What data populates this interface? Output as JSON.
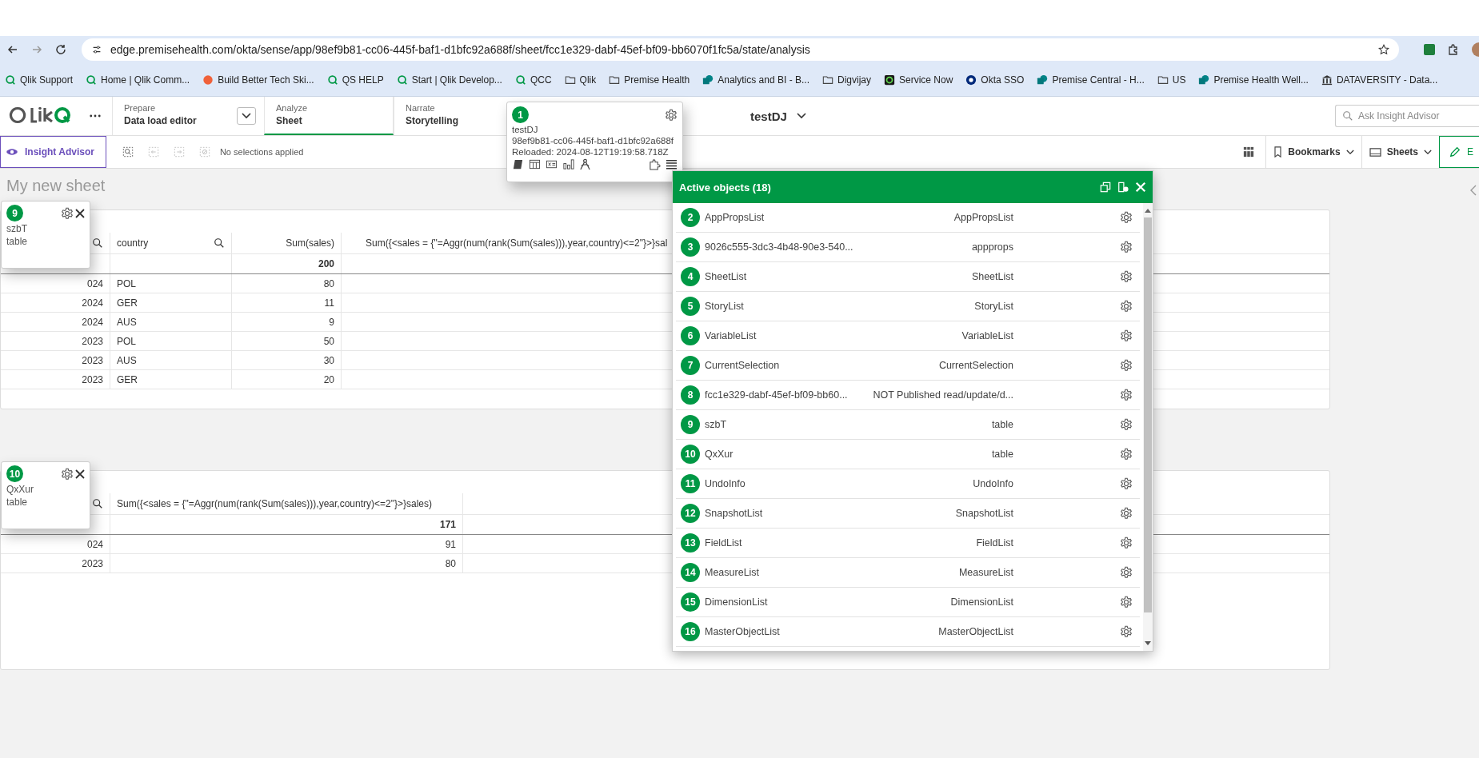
{
  "browser": {
    "url": "edge.premisehealth.com/okta/sense/app/98ef9b81-cc06-445f-baf1-d1bfc92a688f/sheet/fcc1e329-dabf-45ef-bf09-bb6070f1fc5a/state/analysis",
    "bookmarks": [
      {
        "label": "Qlik Support",
        "kind": "qlik"
      },
      {
        "label": "Home | Qlik Comm...",
        "kind": "qlik"
      },
      {
        "label": "Build Better Tech Ski...",
        "kind": "orange"
      },
      {
        "label": "QS HELP",
        "kind": "qlik"
      },
      {
        "label": "Start | Qlik Develop...",
        "kind": "qlik"
      },
      {
        "label": "QCC",
        "kind": "qlik"
      },
      {
        "label": "Qlik",
        "kind": "folder"
      },
      {
        "label": "Premise Health",
        "kind": "folder"
      },
      {
        "label": "Analytics and BI - B...",
        "kind": "sharepoint"
      },
      {
        "label": "Digvijay",
        "kind": "folder"
      },
      {
        "label": "Service Now",
        "kind": "servicenow"
      },
      {
        "label": "Okta SSO",
        "kind": "okta"
      },
      {
        "label": "Premise Central - H...",
        "kind": "sharepoint"
      },
      {
        "label": "US",
        "kind": "folder"
      },
      {
        "label": "Premise Health Well...",
        "kind": "sharepoint"
      },
      {
        "label": "DATAVERSITY - Data...",
        "kind": "columns"
      }
    ]
  },
  "header": {
    "nav": [
      {
        "caption": "Prepare",
        "label": "Data load editor",
        "selected": false,
        "dropdown": true
      },
      {
        "caption": "Analyze",
        "label": "Sheet",
        "selected": true,
        "dropdown": false
      },
      {
        "caption": "Narrate",
        "label": "Storytelling",
        "selected": false,
        "dropdown": false
      }
    ],
    "app_title": "testDJ",
    "search": {
      "placeholder": "Ask Insight Advisor"
    }
  },
  "toolbar": {
    "insight_button": "Insight Advisor",
    "selections": "No selections applied",
    "bookmarks": "Bookmarks",
    "sheets": "Sheets",
    "edit": "E"
  },
  "sheet_title": "My new sheet",
  "tables": [
    {
      "columns": [
        {
          "search": true
        },
        {
          "label": "country",
          "search": true
        },
        {
          "label": "Sum(sales)",
          "search": false,
          "total": "200"
        },
        {
          "label": "Sum({<sales = {\"=Aggr(num(rank(Sum(sales))),year,country)<=2\"}>}sal",
          "search": false
        }
      ],
      "rows": [
        [
          "024",
          "POL",
          "80"
        ],
        [
          "2024",
          "GER",
          "11"
        ],
        [
          "2024",
          "AUS",
          "9"
        ],
        [
          "2023",
          "POL",
          "50"
        ],
        [
          "2023",
          "AUS",
          "30"
        ],
        [
          "2023",
          "GER",
          "20"
        ]
      ],
      "badge": {
        "number": "9",
        "name": "szbT",
        "type": "table"
      }
    },
    {
      "columns": [
        {
          "search": true
        },
        {
          "label": "Sum({<sales = {\"=Aggr(num(rank(Sum(sales))),year,country)<=2\"}>}sales)",
          "search": false,
          "total": "171"
        }
      ],
      "rows": [
        [
          "024",
          "91"
        ],
        [
          "2023",
          "80"
        ]
      ],
      "badge": {
        "number": "10",
        "name": "QxXur",
        "type": "table"
      }
    }
  ],
  "app_info": {
    "number": "1",
    "name": "testDJ",
    "id": "98ef9b81-cc06-445f-baf1-d1bfc92a688f",
    "reloaded": "Reloaded: 2024-08-12T19:19:58.718Z"
  },
  "active_objects": {
    "title": "Active objects (18)",
    "items": [
      {
        "number": "2",
        "name": "AppPropsList",
        "type": "AppPropsList"
      },
      {
        "number": "3",
        "name": "9026c555-3dc3-4b48-90e3-540...",
        "type": "appprops"
      },
      {
        "number": "4",
        "name": "SheetList",
        "type": "SheetList"
      },
      {
        "number": "5",
        "name": "StoryList",
        "type": "StoryList"
      },
      {
        "number": "6",
        "name": "VariableList",
        "type": "VariableList"
      },
      {
        "number": "7",
        "name": "CurrentSelection",
        "type": "CurrentSelection"
      },
      {
        "number": "8",
        "name": "fcc1e329-dabf-45ef-bf09-bb60...",
        "type": "NOT Published read/update/d..."
      },
      {
        "number": "9",
        "name": "szbT",
        "type": "table"
      },
      {
        "number": "10",
        "name": "QxXur",
        "type": "table"
      },
      {
        "number": "11",
        "name": "UndoInfo",
        "type": "UndoInfo"
      },
      {
        "number": "12",
        "name": "SnapshotList",
        "type": "SnapshotList"
      },
      {
        "number": "13",
        "name": "FieldList",
        "type": "FieldList"
      },
      {
        "number": "14",
        "name": "MeasureList",
        "type": "MeasureList"
      },
      {
        "number": "15",
        "name": "DimensionList",
        "type": "DimensionList"
      },
      {
        "number": "16",
        "name": "MasterObjectList",
        "type": "MasterObjectList"
      }
    ]
  }
}
